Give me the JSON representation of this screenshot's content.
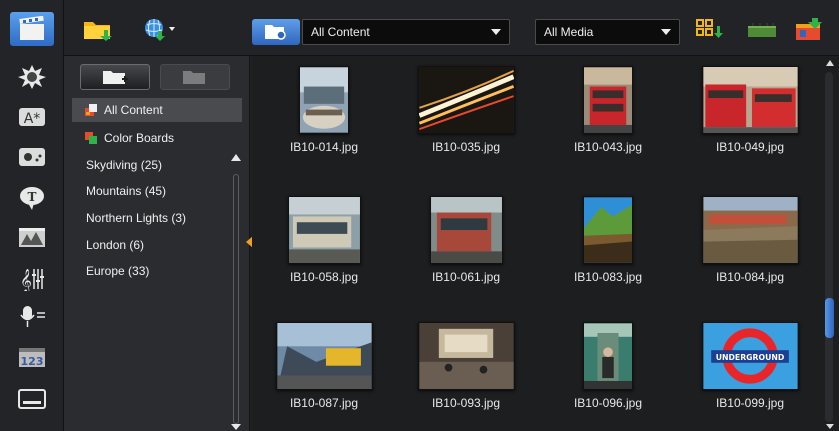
{
  "toolbar": {
    "content_dropdown": "All Content",
    "media_dropdown": "All Media",
    "icons": [
      "import-folder-icon",
      "online-content-icon",
      "browse-folder-icon",
      "sort-icon",
      "timeline-view-icon",
      "export-icon"
    ]
  },
  "rail": {
    "items": [
      "media-icon",
      "instant-project-icon",
      "transition-icon",
      "filter-icon",
      "title-icon",
      "graphic-icon",
      "audio-mixer-icon",
      "voiceover-icon",
      "counter-icon",
      "subtitle-icon"
    ]
  },
  "folders": {
    "items": [
      {
        "label": "All Content",
        "selected": true
      },
      {
        "label": "Color Boards",
        "selected": false
      },
      {
        "label": "Skydiving  (25)",
        "selected": false
      },
      {
        "label": "Mountains  (45)",
        "selected": false
      },
      {
        "label": "Northern Lights  (3)",
        "selected": false
      },
      {
        "label": "London  (6)",
        "selected": false
      },
      {
        "label": "Europe  (33)",
        "selected": false
      }
    ]
  },
  "media": {
    "items": [
      {
        "name": "IB10-014.jpg"
      },
      {
        "name": "IB10-035.jpg"
      },
      {
        "name": "IB10-043.jpg"
      },
      {
        "name": "IB10-049.jpg"
      },
      {
        "name": "IB10-058.jpg"
      },
      {
        "name": "IB10-061.jpg"
      },
      {
        "name": "IB10-083.jpg"
      },
      {
        "name": "IB10-084.jpg"
      },
      {
        "name": "IB10-087.jpg"
      },
      {
        "name": "IB10-093.jpg"
      },
      {
        "name": "IB10-096.jpg"
      },
      {
        "name": "IB10-099.jpg"
      }
    ]
  },
  "colors": {
    "accent": "#3d7fd8",
    "handle": "#f0a020"
  }
}
